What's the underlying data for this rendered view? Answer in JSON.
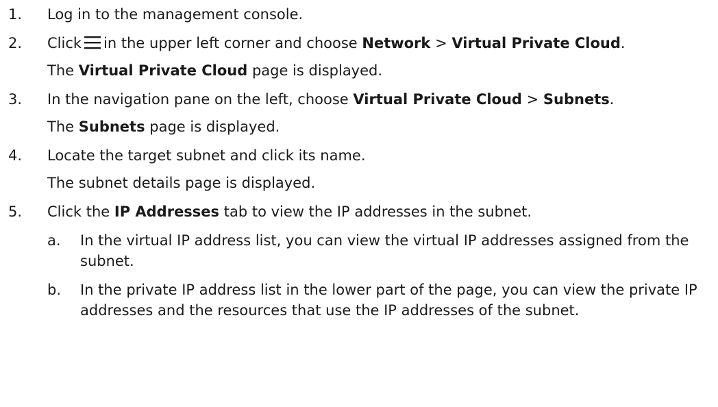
{
  "steps": [
    {
      "num": "1.",
      "text": "Log in to the management console."
    },
    {
      "num": "2.",
      "pre": "Click",
      "icon": "menu-icon",
      "mid": "in the upper left corner and choose",
      "b1": "Network",
      "sep": ">",
      "b2": "Virtual Private Cloud",
      "end": ".",
      "note_pre": "The",
      "note_b": "Virtual Private Cloud",
      "note_post": "page is displayed."
    },
    {
      "num": "3.",
      "pre": "In the navigation pane on the left, choose",
      "b1": "Virtual Private Cloud",
      "sep": ">",
      "b2": "Subnets",
      "end": ".",
      "note_pre": "The",
      "note_b": "Subnets",
      "note_post": "page is displayed."
    },
    {
      "num": "4.",
      "text": "Locate the target subnet and click its name.",
      "note": "The subnet details page is displayed."
    },
    {
      "num": "5.",
      "pre": "Click the",
      "b1": "IP Addresses",
      "post": "tab to view the IP addresses in the subnet.",
      "subs": [
        {
          "letter": "a.",
          "text": "In the virtual IP address list, you can view the virtual IP addresses assigned from the subnet."
        },
        {
          "letter": "b.",
          "text": "In the private IP address list in the lower part of the page, you can view the private IP addresses and the resources that use the IP addresses of the subnet."
        }
      ]
    }
  ]
}
